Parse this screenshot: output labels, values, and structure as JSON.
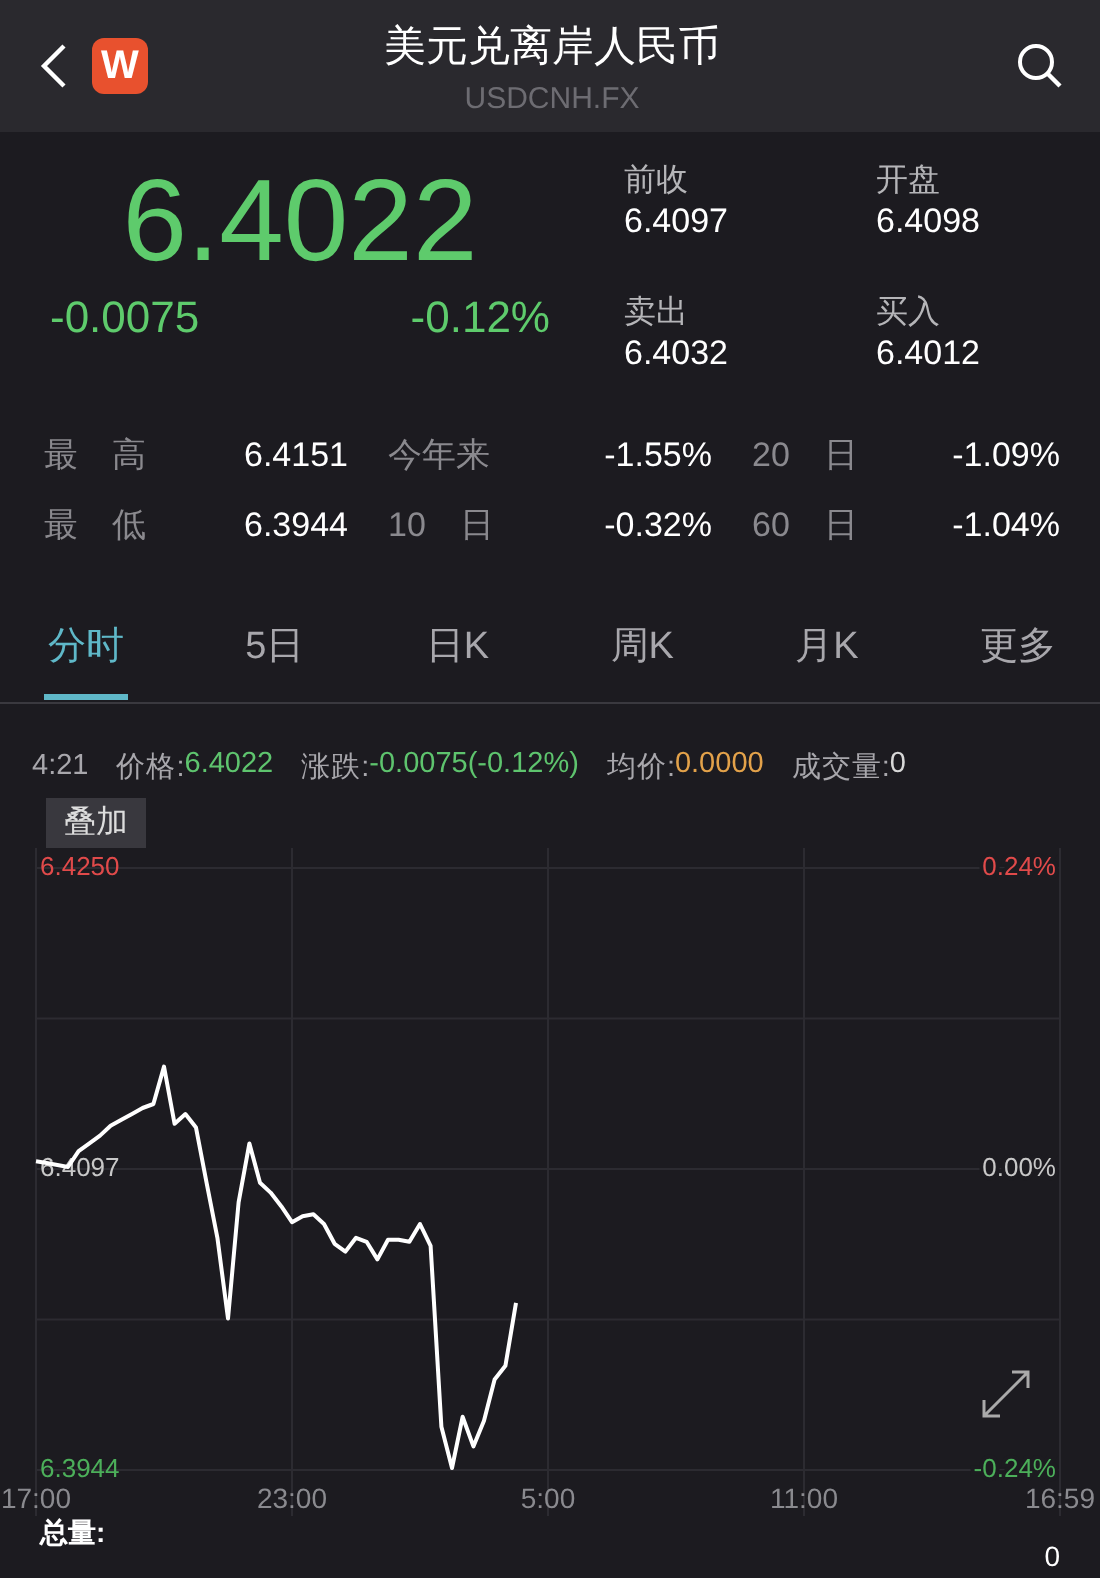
{
  "header": {
    "title": "美元兑离岸人民币",
    "subtitle": "USDCNH.FX",
    "logo": "W"
  },
  "quote": {
    "price": "6.4022",
    "change": "-0.0075",
    "change_pct": "-0.12%",
    "fields": [
      {
        "label": "前收",
        "value": "6.4097"
      },
      {
        "label": "开盘",
        "value": "6.4098"
      },
      {
        "label": "卖出",
        "value": "6.4032"
      },
      {
        "label": "买入",
        "value": "6.4012"
      }
    ]
  },
  "stats": [
    {
      "cells": [
        {
          "label": "最　高",
          "value": "6.4151"
        },
        {
          "label": "今年来",
          "value": "-1.55%"
        },
        {
          "label": "20　日",
          "value": "-1.09%"
        }
      ]
    },
    {
      "cells": [
        {
          "label": "最　低",
          "value": "6.3944"
        },
        {
          "label": "10　日",
          "value": "-0.32%"
        },
        {
          "label": "60　日",
          "value": "-1.04%"
        }
      ]
    }
  ],
  "tabs": [
    {
      "label": "分时",
      "selected": true
    },
    {
      "label": "5日",
      "selected": false
    },
    {
      "label": "日K",
      "selected": false
    },
    {
      "label": "周K",
      "selected": false
    },
    {
      "label": "月K",
      "selected": false
    },
    {
      "label": "更多",
      "selected": false
    }
  ],
  "info": {
    "time": "4:21",
    "items": [
      {
        "label": "价格:",
        "value": "6.4022",
        "color": "#5ec46e"
      },
      {
        "label": "涨跌:",
        "value": "-0.0075(-0.12%)",
        "color": "#5ec46e"
      },
      {
        "label": "均价:",
        "value": "0.0000",
        "color": "#e3a24a"
      },
      {
        "label": "成交量:",
        "value": "0",
        "color": "#d8d8d8"
      }
    ]
  },
  "chart": {
    "overlay_button": "叠加",
    "right_labels": [
      "0.24%",
      "0.00%",
      "-0.24%"
    ],
    "chart_data": {
      "type": "line",
      "grid": true,
      "ylim": [
        6.3944,
        6.425
      ],
      "categories": [
        "17:00",
        null,
        null,
        null,
        null,
        null,
        null,
        null,
        null,
        null,
        null,
        null,
        null,
        null,
        null,
        null,
        null,
        null,
        null,
        null,
        null,
        null,
        null,
        null,
        "23:00",
        null,
        null,
        null,
        null,
        null,
        null,
        null,
        null,
        null,
        null,
        null,
        null,
        null,
        null,
        null,
        null,
        null,
        null,
        null,
        null,
        null,
        null,
        null,
        "5:00",
        null,
        null,
        null,
        null,
        null,
        null,
        null,
        null,
        null,
        null,
        null,
        null,
        null,
        null,
        null,
        null,
        null,
        null,
        null,
        null,
        null,
        null,
        null,
        "11:00",
        null,
        null,
        null,
        null,
        null,
        null,
        null,
        null,
        null,
        null,
        null,
        null,
        null,
        null,
        null,
        null,
        null,
        null,
        null,
        null,
        null,
        null,
        null,
        "16:59"
      ],
      "yticks": [
        {
          "value": 6.425,
          "label": "6.4250"
        },
        {
          "value": 6.4097,
          "label": "6.4097"
        },
        {
          "value": 6.3944,
          "label": "6.3944"
        }
      ],
      "series": [
        {
          "color": "#ffffff",
          "values": [
            6.4101,
            6.41,
            6.4099,
            6.4098,
            6.4106,
            6.411,
            6.4114,
            6.4119,
            6.4122,
            6.4125,
            6.4128,
            6.413,
            6.4149,
            6.412,
            6.4125,
            6.4118,
            6.409,
            6.4062,
            6.4021,
            6.408,
            6.411,
            6.409,
            6.4085,
            6.4078,
            6.407,
            6.4073,
            6.4074,
            6.4069,
            6.4059,
            6.4055,
            6.4062,
            6.406,
            6.4051,
            6.4061,
            6.4061,
            6.406,
            6.4069,
            6.4058,
            6.3966,
            6.3945,
            6.3971,
            6.3956,
            6.3969,
            6.399,
            6.3997,
            6.4029,
            null,
            null,
            null,
            null,
            null,
            null,
            null,
            null,
            null,
            null,
            null,
            null,
            null,
            null,
            null,
            null,
            null,
            null,
            null,
            null,
            null,
            null,
            null,
            null,
            null,
            null,
            null,
            null,
            null,
            null,
            null,
            null,
            null,
            null,
            null,
            null,
            null,
            null,
            null,
            null,
            null,
            null,
            null,
            null,
            null,
            null,
            null,
            null,
            null,
            null,
            null
          ]
        }
      ]
    }
  },
  "volume": {
    "label": "总量:",
    "value": "0"
  }
}
